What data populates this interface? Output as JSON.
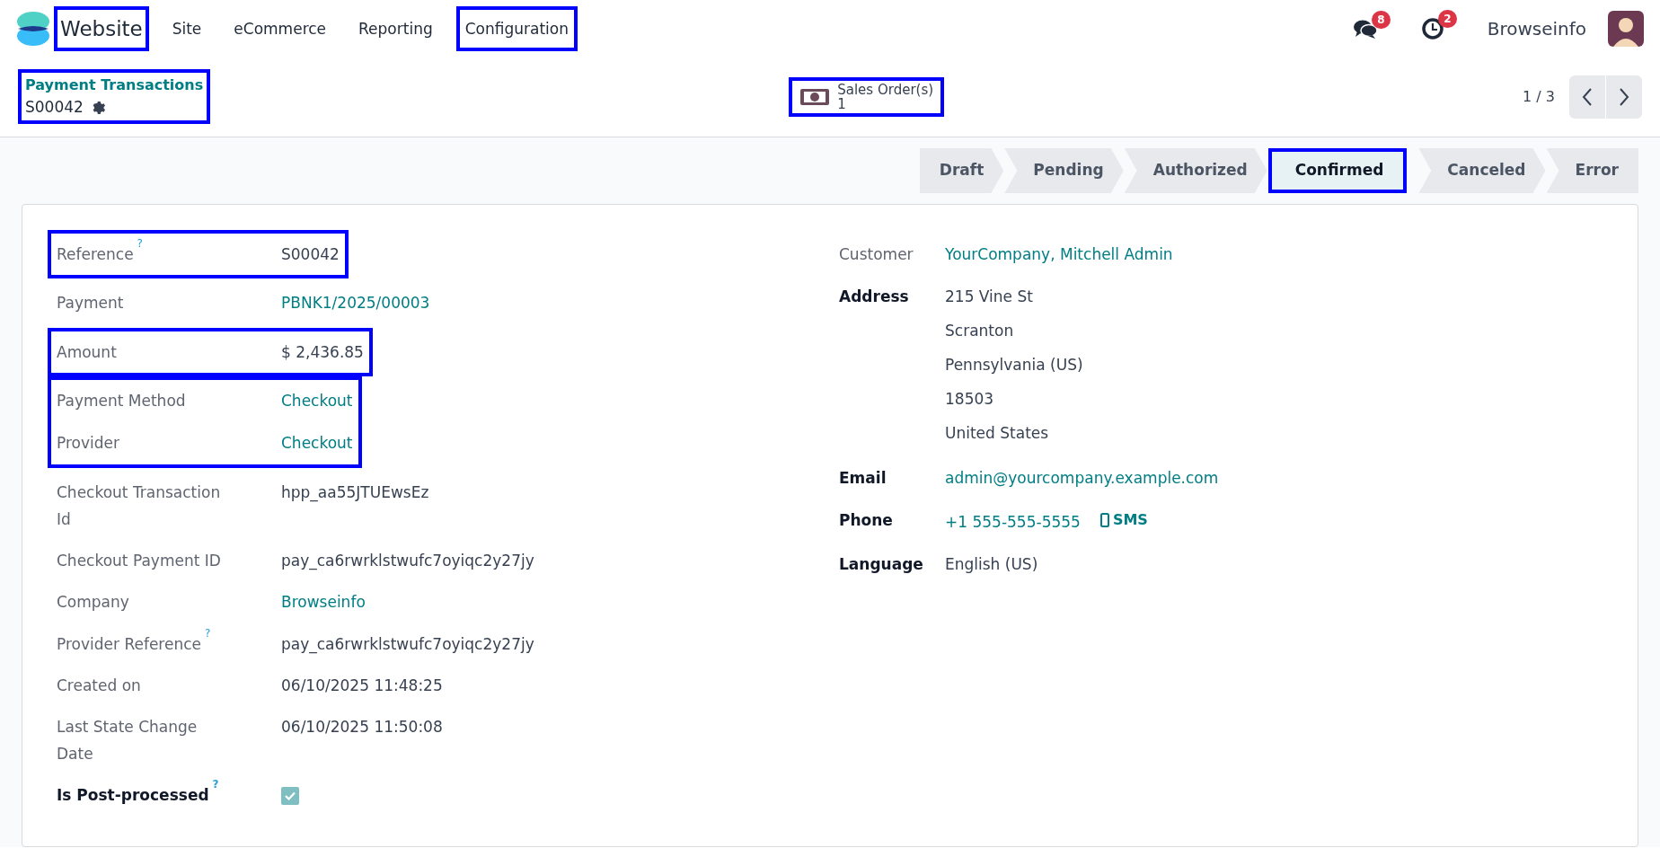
{
  "navbar": {
    "brand": {
      "label": "Website",
      "highlighted": true
    },
    "menus": [
      {
        "label": "Site",
        "highlighted": false
      },
      {
        "label": "eCommerce",
        "highlighted": false
      },
      {
        "label": "Reporting",
        "highlighted": false
      },
      {
        "label": "Configuration",
        "highlighted": true
      }
    ],
    "messages_badge": "8",
    "activities_badge": "2",
    "company": "Browseinfo"
  },
  "breadcrumb": {
    "parent": "Payment Transactions",
    "record": "S00042",
    "highlighted": true
  },
  "smart_button": {
    "label": "Sales Order(s)",
    "count": "1",
    "highlighted": true
  },
  "pager": {
    "value": "1 / 3"
  },
  "stages": [
    {
      "label": "Draft",
      "selected": false,
      "highlighted": false
    },
    {
      "label": "Pending",
      "selected": false,
      "highlighted": false
    },
    {
      "label": "Authorized",
      "selected": false,
      "highlighted": false
    },
    {
      "label": "Confirmed",
      "selected": true,
      "highlighted": true
    },
    {
      "label": "Canceled",
      "selected": false,
      "highlighted": false
    },
    {
      "label": "Error",
      "selected": false,
      "highlighted": false
    }
  ],
  "left_groups": [
    {
      "highlighted": true,
      "fields": [
        {
          "label": "Reference",
          "help": "?",
          "emphasized": false,
          "kind": "text",
          "value": "S00042"
        }
      ]
    },
    {
      "highlighted": false,
      "fields": [
        {
          "label": "Payment",
          "emphasized": false,
          "kind": "link",
          "value": "PBNK1/2025/00003"
        }
      ]
    },
    {
      "highlighted": true,
      "fields": [
        {
          "label": "Amount",
          "emphasized": false,
          "kind": "text",
          "value": "$ 2,436.85"
        }
      ]
    },
    {
      "highlighted": true,
      "fields": [
        {
          "label": "Payment Method",
          "emphasized": false,
          "kind": "link",
          "value": "Checkout"
        },
        {
          "label": "Provider",
          "emphasized": false,
          "kind": "link",
          "value": "Checkout"
        }
      ]
    },
    {
      "highlighted": false,
      "fields": [
        {
          "label": "Checkout Transaction Id",
          "emphasized": false,
          "kind": "text",
          "value": "hpp_aa55JTUEwsEz"
        },
        {
          "label": "Checkout Payment ID",
          "emphasized": false,
          "kind": "text",
          "value": "pay_ca6rwrklstwufc7oyiqc2y27jy"
        },
        {
          "label": "Company",
          "emphasized": false,
          "kind": "link",
          "value": "Browseinfo"
        },
        {
          "label": "Provider Reference",
          "help": "?",
          "emphasized": false,
          "kind": "text",
          "value": "pay_ca6rwrklstwufc7oyiqc2y27jy"
        },
        {
          "label": "Created on",
          "emphasized": false,
          "kind": "text",
          "value": "06/10/2025 11:48:25"
        },
        {
          "label": "Last State Change Date",
          "emphasized": false,
          "kind": "text",
          "value": "06/10/2025 11:50:08"
        },
        {
          "label": "Is Post-processed",
          "help": "?",
          "emphasized": true,
          "kind": "checkbox",
          "checked": true
        }
      ]
    }
  ],
  "right_fields": [
    {
      "label": "Customer",
      "emphasized": false,
      "kind": "link",
      "value": "YourCompany, Mitchell Admin"
    },
    {
      "label": "Address",
      "emphasized": true,
      "kind": "lines",
      "lines": [
        "215 Vine St",
        "Scranton",
        "Pennsylvania (US)",
        "18503",
        "United States"
      ]
    },
    {
      "label": "Email",
      "emphasized": true,
      "kind": "link",
      "value": "admin@yourcompany.example.com"
    },
    {
      "label": "Phone",
      "emphasized": true,
      "kind": "link",
      "value": "+1 555-555-5555",
      "action": "SMS"
    },
    {
      "label": "Language",
      "emphasized": true,
      "kind": "text",
      "value": "English (US)"
    }
  ]
}
